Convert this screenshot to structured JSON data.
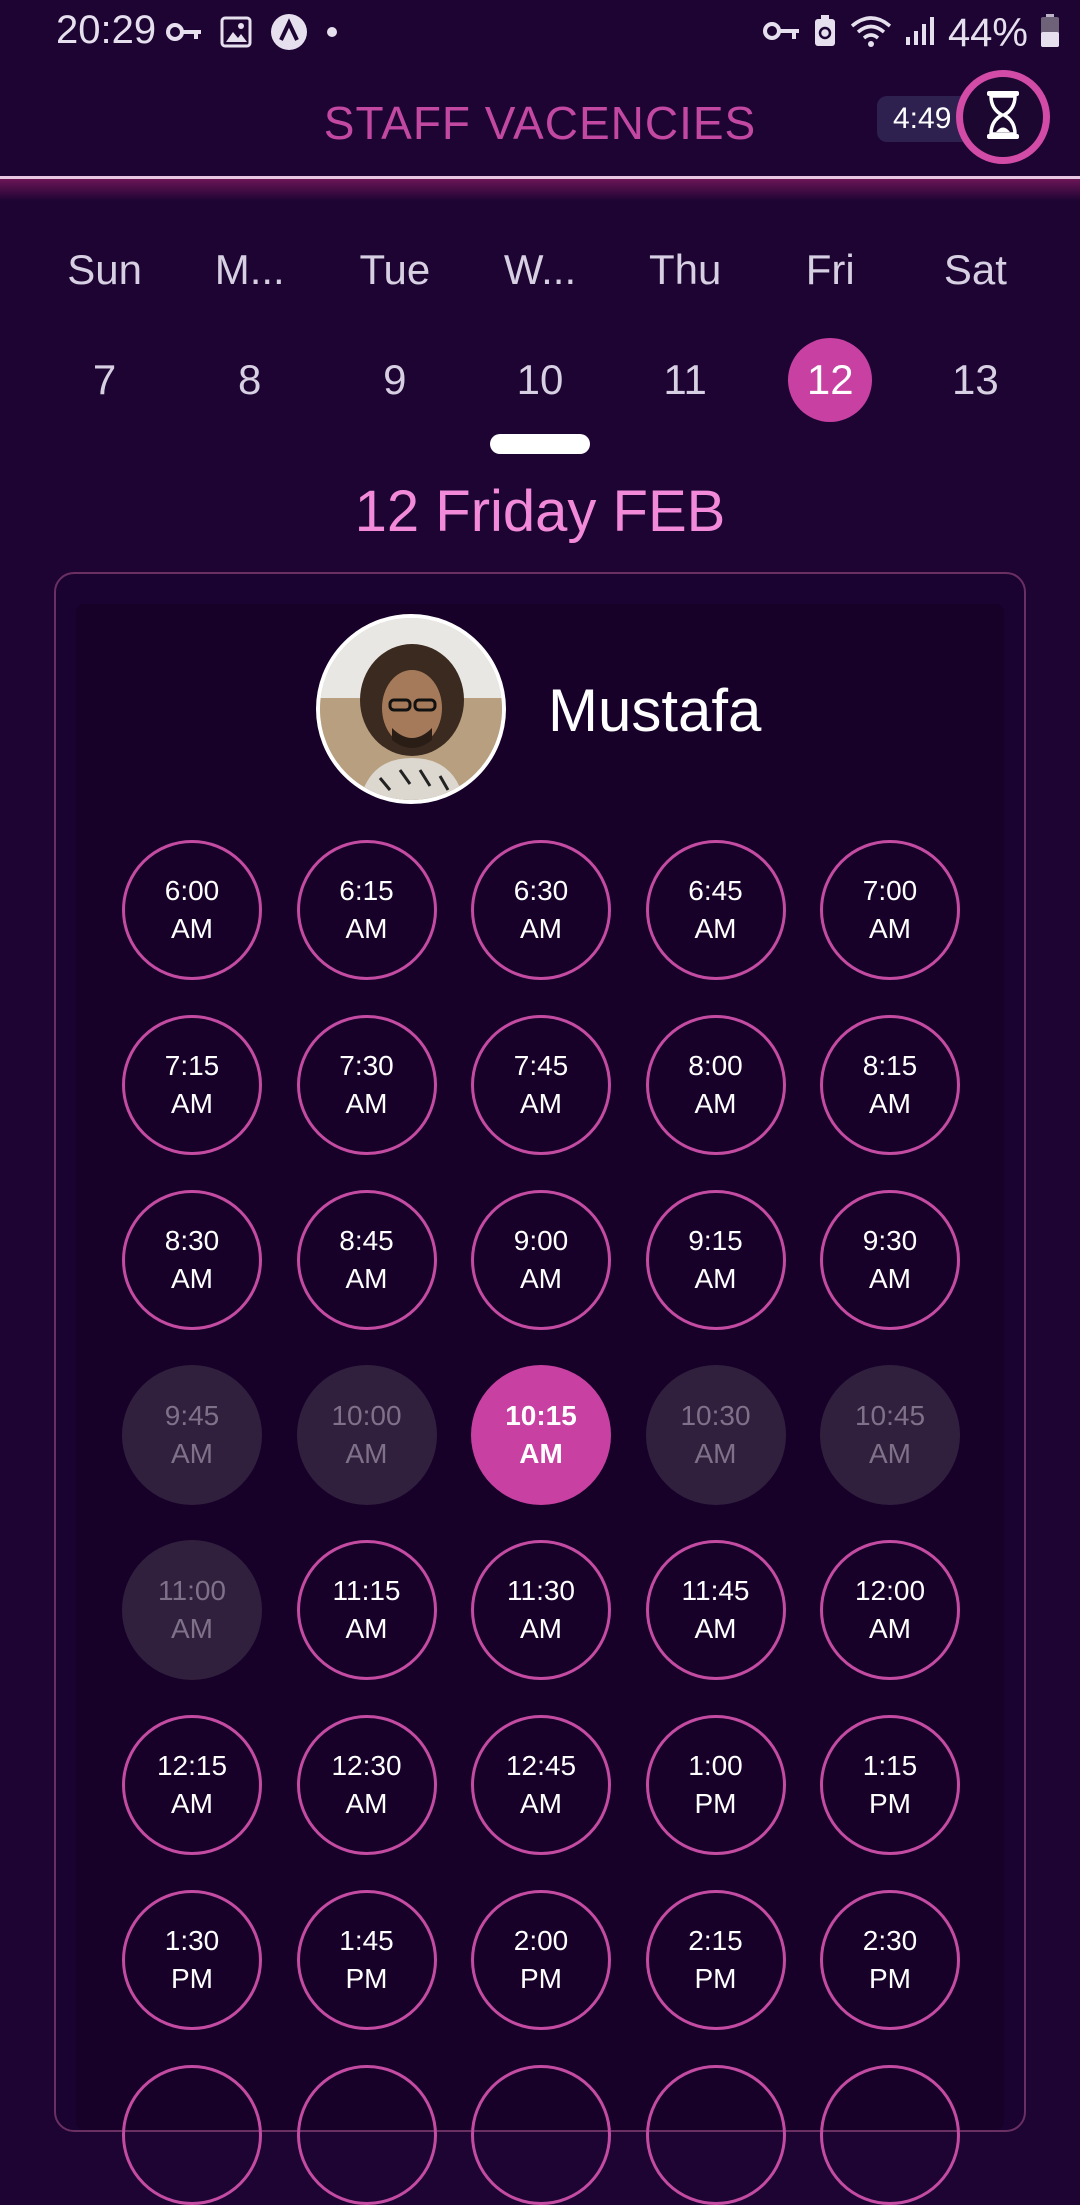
{
  "status_bar": {
    "time": "20:29",
    "battery": "44%",
    "left_icons": [
      "key-icon",
      "image-icon",
      "app-a-icon",
      "dot-icon"
    ],
    "right_icons": [
      "vpn-key-icon",
      "battery-saver-icon",
      "wifi-icon",
      "signal-icon",
      "battery-icon"
    ]
  },
  "header": {
    "title": "STAFF VACENCIES",
    "timer": "4:49",
    "accent_color": "#c248a2"
  },
  "week": {
    "days": [
      {
        "weekday": "Sun",
        "day": "7"
      },
      {
        "weekday": "M...",
        "day": "8"
      },
      {
        "weekday": "Tue",
        "day": "9"
      },
      {
        "weekday": "W...",
        "day": "10"
      },
      {
        "weekday": "Thu",
        "day": "11"
      },
      {
        "weekday": "Fri",
        "day": "12"
      },
      {
        "weekday": "Sat",
        "day": "13"
      }
    ],
    "selected_index": 5
  },
  "date_heading": "12 Friday FEB",
  "staff": {
    "name": "Mustafa"
  },
  "slots": [
    {
      "time": "6:00",
      "period": "AM",
      "state": "available"
    },
    {
      "time": "6:15",
      "period": "AM",
      "state": "available"
    },
    {
      "time": "6:30",
      "period": "AM",
      "state": "available"
    },
    {
      "time": "6:45",
      "period": "AM",
      "state": "available"
    },
    {
      "time": "7:00",
      "period": "AM",
      "state": "available"
    },
    {
      "time": "7:15",
      "period": "AM",
      "state": "available"
    },
    {
      "time": "7:30",
      "period": "AM",
      "state": "available"
    },
    {
      "time": "7:45",
      "period": "AM",
      "state": "available"
    },
    {
      "time": "8:00",
      "period": "AM",
      "state": "available"
    },
    {
      "time": "8:15",
      "period": "AM",
      "state": "available"
    },
    {
      "time": "8:30",
      "period": "AM",
      "state": "available"
    },
    {
      "time": "8:45",
      "period": "AM",
      "state": "available"
    },
    {
      "time": "9:00",
      "period": "AM",
      "state": "available"
    },
    {
      "time": "9:15",
      "period": "AM",
      "state": "available"
    },
    {
      "time": "9:30",
      "period": "AM",
      "state": "available"
    },
    {
      "time": "9:45",
      "period": "AM",
      "state": "disabled"
    },
    {
      "time": "10:00",
      "period": "AM",
      "state": "disabled"
    },
    {
      "time": "10:15",
      "period": "AM",
      "state": "selected"
    },
    {
      "time": "10:30",
      "period": "AM",
      "state": "disabled"
    },
    {
      "time": "10:45",
      "period": "AM",
      "state": "disabled"
    },
    {
      "time": "11:00",
      "period": "AM",
      "state": "disabled"
    },
    {
      "time": "11:15",
      "period": "AM",
      "state": "available"
    },
    {
      "time": "11:30",
      "period": "AM",
      "state": "available"
    },
    {
      "time": "11:45",
      "period": "AM",
      "state": "available"
    },
    {
      "time": "12:00",
      "period": "AM",
      "state": "available"
    },
    {
      "time": "12:15",
      "period": "AM",
      "state": "available"
    },
    {
      "time": "12:30",
      "period": "AM",
      "state": "available"
    },
    {
      "time": "12:45",
      "period": "AM",
      "state": "available"
    },
    {
      "time": "1:00",
      "period": "PM",
      "state": "available"
    },
    {
      "time": "1:15",
      "period": "PM",
      "state": "available"
    },
    {
      "time": "1:30",
      "period": "PM",
      "state": "available"
    },
    {
      "time": "1:45",
      "period": "PM",
      "state": "available"
    },
    {
      "time": "2:00",
      "period": "PM",
      "state": "available"
    },
    {
      "time": "2:15",
      "period": "PM",
      "state": "available"
    },
    {
      "time": "2:30",
      "period": "PM",
      "state": "available"
    },
    {
      "time": "",
      "period": "",
      "state": "available"
    },
    {
      "time": "",
      "period": "",
      "state": "available"
    },
    {
      "time": "",
      "period": "",
      "state": "available"
    },
    {
      "time": "",
      "period": "",
      "state": "available"
    },
    {
      "time": "",
      "period": "",
      "state": "available"
    }
  ]
}
